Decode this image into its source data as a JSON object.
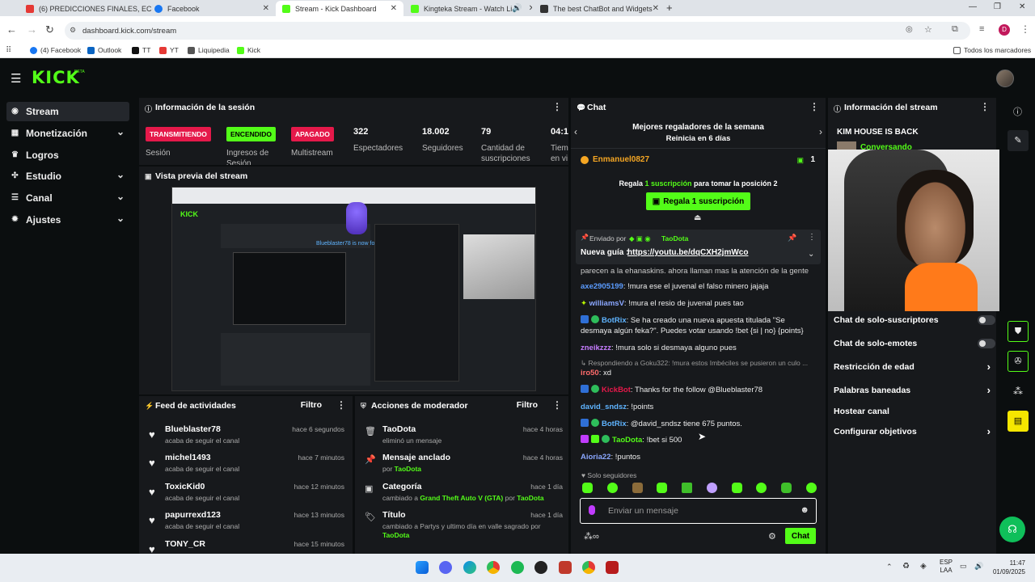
{
  "browser": {
    "tabs": [
      {
        "title": "(6) PREDICCIONES FINALES, EC",
        "color": "#e53935"
      },
      {
        "title": "Facebook",
        "color": "#1877f2"
      },
      {
        "title": "Stream - Kick Dashboard",
        "color": "#53fc18"
      },
      {
        "title": "Kingteka Stream - Watch Li",
        "color": "#53fc18"
      },
      {
        "title": "The best ChatBot and Widgets",
        "color": "#333333"
      }
    ],
    "url": "dashboard.kick.com/stream",
    "profile_initial": "D",
    "bookmarks": [
      {
        "label": "(4) Facebook",
        "color": "#1877f2"
      },
      {
        "label": "Outlook",
        "color": "#0a64c2"
      },
      {
        "label": "TT",
        "color": "#111111"
      },
      {
        "label": "YT",
        "color": "#e53935"
      },
      {
        "label": "Liquipedia",
        "color": "#555555"
      },
      {
        "label": "Kick",
        "color": "#53fc18"
      }
    ],
    "all_bookmarks": "Todos los marcadores"
  },
  "kick": {
    "logo": "KICK",
    "logo_sup": "BETA",
    "accent": "#53fc18"
  },
  "sidebar": {
    "items": [
      {
        "label": "Stream",
        "icon": "stream-icon",
        "glyph": "◉"
      },
      {
        "label": "Monetización",
        "icon": "money-icon",
        "glyph": "▦"
      },
      {
        "label": "Logros",
        "icon": "trophy-icon",
        "glyph": "♛"
      },
      {
        "label": "Estudio",
        "icon": "studio-icon",
        "glyph": "✣"
      },
      {
        "label": "Canal",
        "icon": "channel-icon",
        "glyph": "☰"
      },
      {
        "label": "Ajustes",
        "icon": "gear-icon",
        "glyph": "✹"
      }
    ]
  },
  "session": {
    "title": "Información de la sesión",
    "stats": [
      {
        "badge": "TRANSMITIENDO",
        "label": "Sesión",
        "badge_bg": "#e5194a"
      },
      {
        "badge": "ENCENDIDO",
        "label": "Ingresos de Sesión",
        "badge_bg": "#53fc18"
      },
      {
        "badge": "APAGADO",
        "label": "Multistream",
        "badge_bg": "#e5194a"
      },
      {
        "value": "322",
        "label": "Espectadores"
      },
      {
        "value": "18.002",
        "label": "Seguidores"
      },
      {
        "value": "79",
        "label": "Cantidad de suscripciones"
      },
      {
        "value": "04:1",
        "label": "Tiem en vi"
      }
    ]
  },
  "preview": {
    "title": "Vista previa del stream"
  },
  "activity": {
    "title": "Feed de actividades",
    "filter": "Filtro",
    "items": [
      {
        "name": "Blueblaster78",
        "sub": "acaba de seguir el canal",
        "time": "hace 6 segundos"
      },
      {
        "name": "michel1493",
        "sub": "acaba de seguir el canal",
        "time": "hace 7 minutos"
      },
      {
        "name": "ToxicKid0",
        "sub": "acaba de seguir el canal",
        "time": "hace 12 minutos"
      },
      {
        "name": "papurrexd123",
        "sub": "acaba de seguir el canal",
        "time": "hace 13 minutos"
      },
      {
        "name": "TONY_CR",
        "sub": "",
        "time": "hace 15 minutos"
      }
    ]
  },
  "mod": {
    "title": "Acciones de moderador",
    "filter": "Filtro",
    "items": [
      {
        "name": "TaoDota",
        "sub": "eliminó un mensaje",
        "time": "hace 4 horas",
        "icon": "trash-icon",
        "glyph": "🗑"
      },
      {
        "name": "Mensaje anclado",
        "sub_pre": "por ",
        "sub_hl": "TaoDota",
        "time": "hace 4 horas",
        "icon": "pin-icon",
        "glyph": "📌"
      },
      {
        "name": "Categoría",
        "sub_pre": "cambiado a ",
        "sub_hl": "Grand Theft Auto V (GTA)",
        "sub_mid": " por ",
        "sub_hl2": "TaoDota",
        "time": "hace 1 día",
        "icon": "category-icon",
        "glyph": "▣"
      },
      {
        "name": "Título",
        "sub_pre": "cambiado a Partys y ultimo día en valle sagrado por ",
        "sub_hl": "TaoDota",
        "time": "hace 1 día",
        "icon": "title-icon",
        "glyph": "🏷"
      }
    ]
  },
  "chat": {
    "title": "Chat",
    "top_title": "Mejores regaladores de la semana",
    "top_sub": "Reinicia en 6 días",
    "top_user": "Enmanuel0827",
    "top_count": "1",
    "gift_pre": "Regala ",
    "gift_hl": "1 suscripción",
    "gift_post": " para tomar la posición 2",
    "gift_button": "Regala 1 suscripción",
    "pinned_by_label": "Enviado por",
    "pinned_user": "TaoDota",
    "pinned_msg_label": "Nueva guía : ",
    "pinned_link": "https://youtu.be/dqCXH2jmWco",
    "messages": [
      {
        "user": "",
        "text": "parecen a la ehanaskins. ahora llaman mas la atención de la gente xd",
        "color": "#eee"
      },
      {
        "user": "axe2905199",
        "text": "!mura ese el juvenal el falso minero jajaja",
        "color": "#5b9cff"
      },
      {
        "user": "williamsV",
        "text": "!mura el resio de juvenal pues tao",
        "color": "#8aa7ff"
      },
      {
        "user": "BotRix",
        "text": "Se ha creado una nueva apuesta titulada \"Se desmaya algún feka?\". Puedes votar usando !bet {si | no} {points}",
        "color": "#5fb4ff"
      },
      {
        "user": "zneikzzz",
        "text": "!mura solo si desmaya alguno pues",
        "color": "#c77dff"
      },
      {
        "user": "iro50",
        "reply": "Respondiendo a Goku322: !mura estos Imbéciles se pusieron un culo ...",
        "text": "xd",
        "color": "#ff6b6b"
      },
      {
        "user": "KickBot",
        "text": "Thanks for the follow @Blueblaster78",
        "color": "#e5194a"
      },
      {
        "user": "david_sndsz",
        "text": "!points",
        "color": "#5fb4ff"
      },
      {
        "user": "BotRix",
        "text": "@david_sndsz tiene 675 puntos.",
        "color": "#5fb4ff"
      },
      {
        "user": "TaoDota",
        "text": "!bet si 500",
        "color": "#53fc18"
      },
      {
        "user": "Aioria22",
        "text": "!puntos",
        "color": "#8aa7ff"
      }
    ],
    "followers_only": "Solo seguidores",
    "input_placeholder": "Enviar un mensaje",
    "send_button": "Chat"
  },
  "stream_info": {
    "title": "Información del stream",
    "stream_title": "KIM HOUSE IS BACK",
    "status": "Conversando",
    "settings": [
      {
        "label": "Chat de solo-suscriptores",
        "control": "toggle"
      },
      {
        "label": "Chat de solo-emotes",
        "control": "toggle"
      },
      {
        "label": "Restricción de edad",
        "control": "chevron"
      },
      {
        "label": "Palabras baneadas",
        "control": "chevron"
      },
      {
        "label": "Hostear canal",
        "control": "none"
      },
      {
        "label": "Configurar objetivos",
        "control": "chevron"
      }
    ]
  },
  "taskbar": {
    "lang": "ESP",
    "lang2": "LAA",
    "time": "11:47",
    "date": "01/09/2025"
  }
}
